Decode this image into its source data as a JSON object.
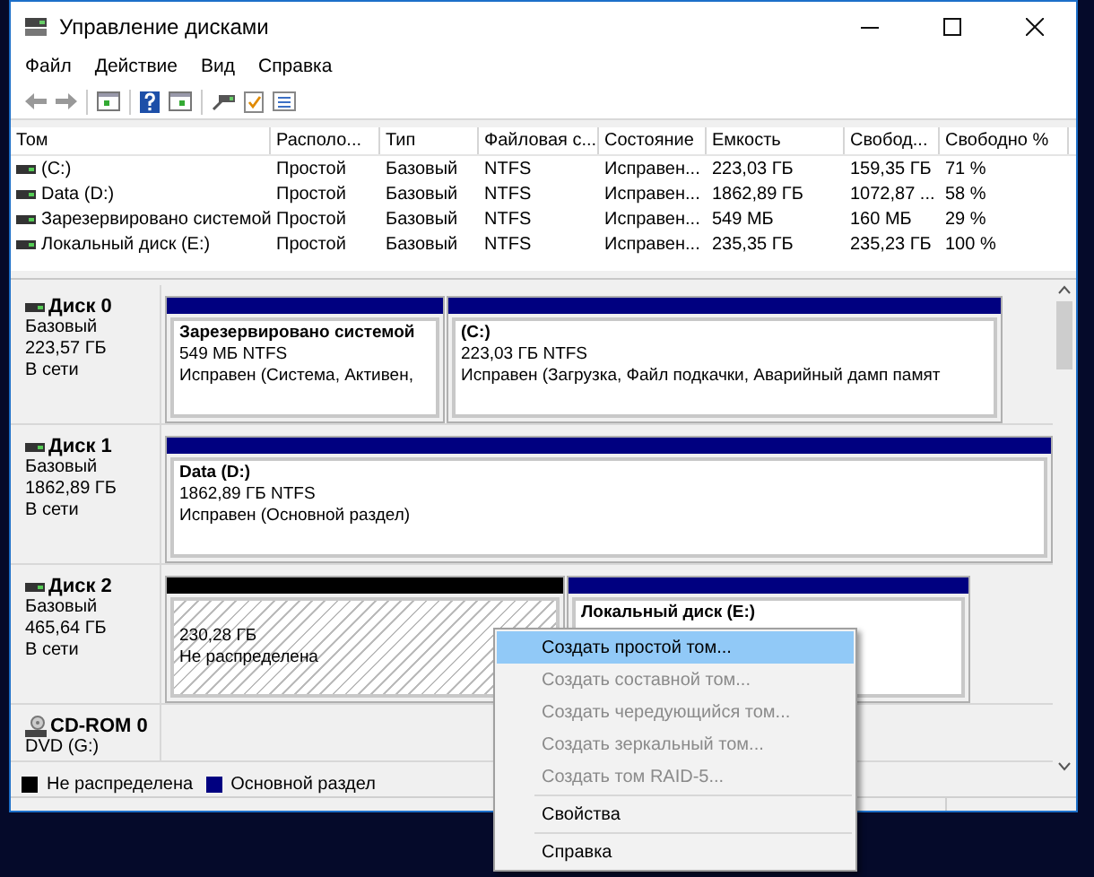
{
  "window": {
    "title": "Управление дисками"
  },
  "menu": [
    {
      "label": "Файл"
    },
    {
      "label": "Действие"
    },
    {
      "label": "Вид"
    },
    {
      "label": "Справка"
    }
  ],
  "volumes": {
    "columns": [
      "Том",
      "Располо...",
      "Тип",
      "Файловая с...",
      "Состояние",
      "Емкость",
      "Свобод...",
      "Свободно %"
    ],
    "rows": [
      [
        "(C:)",
        "Простой",
        "Базовый",
        "NTFS",
        "Исправен...",
        "223,03 ГБ",
        "159,35 ГБ",
        "71 %"
      ],
      [
        "Data (D:)",
        "Простой",
        "Базовый",
        "NTFS",
        "Исправен...",
        "1862,89 ГБ",
        "1072,87 ...",
        "58 %"
      ],
      [
        "Зарезервировано системой",
        "Простой",
        "Базовый",
        "NTFS",
        "Исправен...",
        "549 МБ",
        "160 МБ",
        "29 %"
      ],
      [
        "Локальный диск (E:)",
        "Простой",
        "Базовый",
        "NTFS",
        "Исправен...",
        "235,35 ГБ",
        "235,23 ГБ",
        "100 %"
      ]
    ]
  },
  "disks": [
    {
      "kind": "disk",
      "name": "Диск 0",
      "type": "Базовый",
      "size": "223,57 ГБ",
      "status": "В сети",
      "partitions": [
        {
          "kind": "primary",
          "title": "Зарезервировано системой",
          "size": "549 МБ NTFS",
          "status": "Исправен (Система, Активен,"
        },
        {
          "kind": "primary",
          "title": "(C:)",
          "size": "223,03 ГБ NTFS",
          "status": "Исправен (Загрузка, Файл подкачки, Аварийный дамп памят"
        }
      ]
    },
    {
      "kind": "disk",
      "name": "Диск 1",
      "type": "Базовый",
      "size": "1862,89 ГБ",
      "status": "В сети",
      "partitions": [
        {
          "kind": "primary",
          "title": "Data  (D:)",
          "size": "1862,89 ГБ NTFS",
          "status": "Исправен (Основной раздел)"
        }
      ]
    },
    {
      "kind": "disk",
      "name": "Диск 2",
      "type": "Базовый",
      "size": "465,64 ГБ",
      "status": "В сети",
      "partitions": [
        {
          "kind": "unallocated",
          "size": "230,28 ГБ",
          "status": "Не распределена"
        },
        {
          "kind": "primary",
          "title": "Локальный диск (E:)"
        }
      ]
    },
    {
      "kind": "cdrom",
      "name": "CD-ROM 0",
      "type": "DVD (G:)"
    }
  ],
  "legend": [
    {
      "label": "Не распределена",
      "color": "#000000"
    },
    {
      "label": "Основной раздел",
      "color": "#000080"
    }
  ],
  "context_menu": [
    {
      "label": "Создать простой том...",
      "selected": true,
      "disabled": false
    },
    {
      "label": "Создать составной том...",
      "selected": false,
      "disabled": true
    },
    {
      "label": "Создать чередующийся том...",
      "selected": false,
      "disabled": true
    },
    {
      "label": "Создать зеркальный том...",
      "selected": false,
      "disabled": true
    },
    {
      "label": "Создать том RAID-5...",
      "selected": false,
      "disabled": true
    },
    {
      "label": "Свойства",
      "selected": false,
      "disabled": false,
      "separator_before": true
    },
    {
      "label": "Справка",
      "selected": false,
      "disabled": false,
      "separator_before": true
    }
  ]
}
